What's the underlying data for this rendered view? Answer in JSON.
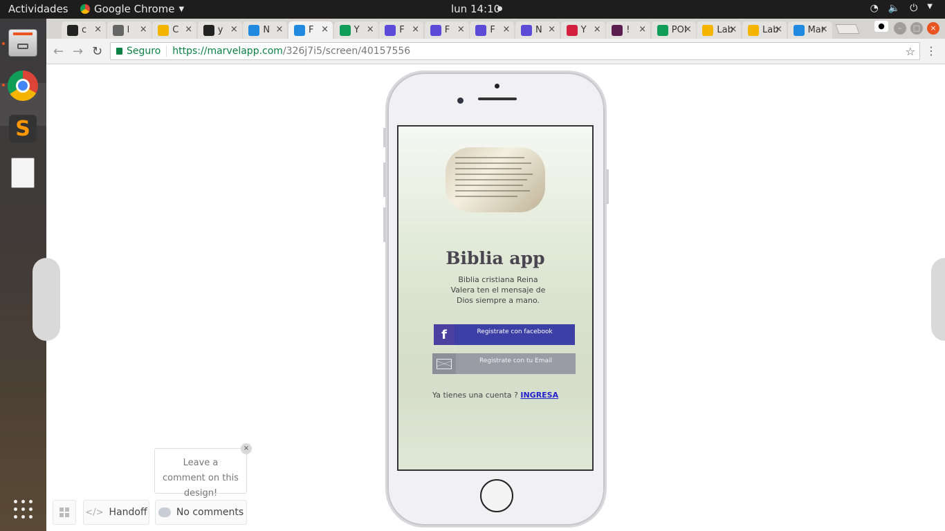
{
  "topbar": {
    "activities": "Actividades",
    "app_name": "Google Chrome",
    "clock": "lun 14:10"
  },
  "tabs": [
    {
      "label": "c",
      "icon": "github-icon",
      "color": "#222222"
    },
    {
      "label": "l",
      "icon": "page-icon",
      "color": "#666666"
    },
    {
      "label": "C",
      "icon": "slides-icon",
      "color": "#f4b400"
    },
    {
      "label": "y",
      "icon": "github-icon",
      "color": "#222222"
    },
    {
      "label": "N",
      "icon": "marvel-icon",
      "color": "#1f8ae0"
    },
    {
      "label": "F",
      "icon": "marvel-icon",
      "color": "#1f8ae0"
    },
    {
      "label": "Y",
      "icon": "drive-icon",
      "color": "#0f9d58"
    },
    {
      "label": "F",
      "icon": "form-icon",
      "color": "#5b4bd6"
    },
    {
      "label": "F",
      "icon": "form-icon",
      "color": "#5b4bd6"
    },
    {
      "label": "F",
      "icon": "form-icon",
      "color": "#5b4bd6"
    },
    {
      "label": "N",
      "icon": "form-icon",
      "color": "#5b4bd6"
    },
    {
      "label": "Y",
      "icon": "pocket-icon",
      "color": "#d3203d"
    },
    {
      "label": "!",
      "icon": "slack-icon",
      "color": "#5b1e4f"
    },
    {
      "label": "POI",
      "icon": "sheets-icon",
      "color": "#0f9d58"
    },
    {
      "label": "Lab",
      "icon": "code-icon",
      "color": "#f4b400"
    },
    {
      "label": "Lab",
      "icon": "code-icon",
      "color": "#f4b400"
    },
    {
      "label": "Mar",
      "icon": "marvel-icon",
      "color": "#1f8ae0"
    }
  ],
  "address": {
    "secure_label": "Seguro",
    "url_host": "https://marvelapp.com",
    "url_path": "/326j7i5/screen/40157556"
  },
  "app": {
    "title": "Biblia app",
    "subtitle": "Biblia cristiana Reina Valera ten el mensaje de Dios siempre a mano.",
    "facebook_label": "Registrate con  facebook",
    "email_label": "Registrate con tu  Email",
    "already_text": "Ya tienes una cuenta ? ",
    "login_link": "INGRESA "
  },
  "tooltip": {
    "text": "Leave a comment on this design!"
  },
  "bottom": {
    "handoff": "Handoff",
    "comments": "No comments"
  }
}
